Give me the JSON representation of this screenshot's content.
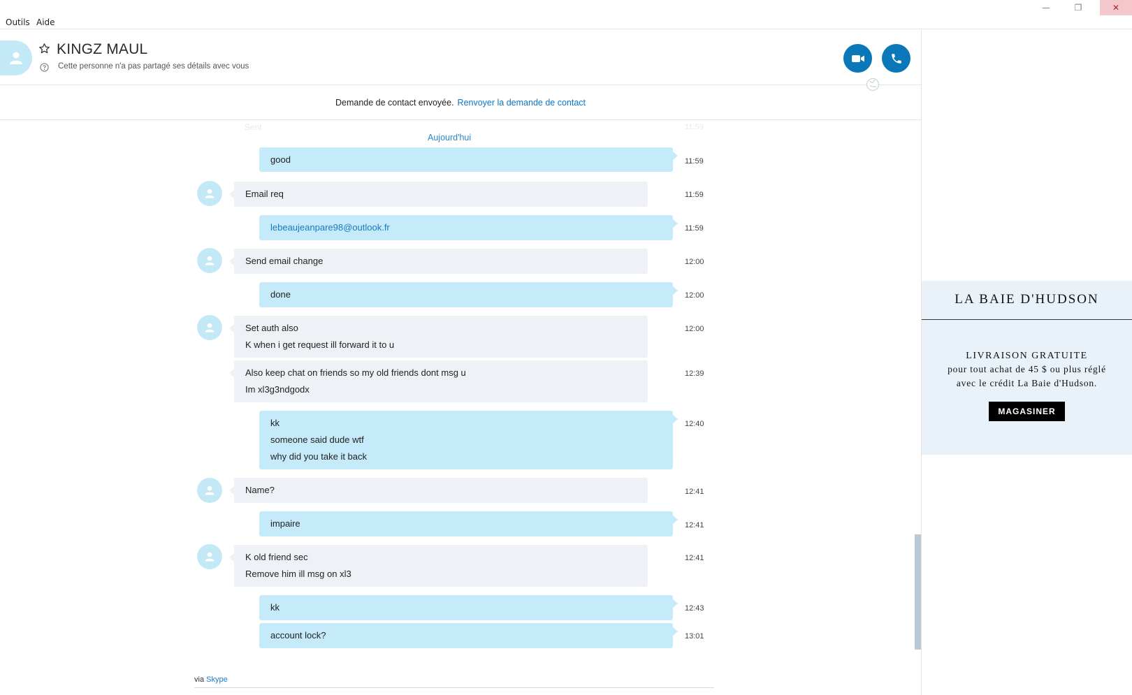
{
  "menu": {
    "items": [
      "Outils",
      "Aide"
    ]
  },
  "window_controls": {
    "minimize": "—",
    "maximize": "❐",
    "close": "✕"
  },
  "header": {
    "contact_name": "KINGZ MAUL",
    "status": "Cette personne n'a pas partagé ses détails avec vous"
  },
  "request_notice": {
    "text": "Demande de contact envoyée.",
    "link": "Renvoyer la demande de contact"
  },
  "chat": {
    "faded_top_text": "Sent",
    "faded_top_time": "11:59",
    "day_label": "Aujourd'hui",
    "messages": [
      {
        "direction": "out",
        "lines": [
          "good"
        ],
        "time": "11:59"
      },
      {
        "direction": "in",
        "lines": [
          "Email req"
        ],
        "time": "11:59"
      },
      {
        "direction": "out",
        "lines": [
          "lebeaujeanpare98@outlook.fr"
        ],
        "time": "11:59"
      },
      {
        "direction": "in",
        "lines": [
          "Send email change"
        ],
        "time": "12:00"
      },
      {
        "direction": "out",
        "lines": [
          "done"
        ],
        "time": "12:00"
      },
      {
        "direction": "in",
        "lines": [
          "Set auth also",
          "K when i get request ill forward it to u"
        ],
        "time": "12:00"
      },
      {
        "direction": "in",
        "lines": [
          "Also keep chat on friends so my old friends dont msg u",
          "Im xl3g3ndgodx"
        ],
        "time": "12:39"
      },
      {
        "direction": "out",
        "lines": [
          "kk",
          "someone said dude wtf",
          "why did you take it back"
        ],
        "time": "12:40"
      },
      {
        "direction": "in",
        "lines": [
          "Name?"
        ],
        "time": "12:41"
      },
      {
        "direction": "out",
        "lines": [
          "impaire"
        ],
        "time": "12:41"
      },
      {
        "direction": "in",
        "lines": [
          "K old friend sec",
          "Remove him ill msg on xl3"
        ],
        "time": "12:41"
      },
      {
        "direction": "out",
        "lines": [
          "kk"
        ],
        "time": "12:43"
      },
      {
        "direction": "out",
        "lines": [
          "account lock?"
        ],
        "time": "13:01"
      }
    ],
    "via_prefix": "via",
    "via_link": "Skype"
  },
  "ad": {
    "logo": "LA BAIE D'HUDSON",
    "headline": "LIVRAISON GRATUITE",
    "body_line1": "pour tout achat de 45 $ ou plus réglé",
    "body_line2": "avec le crédit La Baie d'Hudson.",
    "button": "MAGASINER"
  },
  "colors": {
    "accent": "#0a78b8",
    "link": "#1878c0",
    "bubble_out": "#c5eafa",
    "bubble_in": "#eef1f5",
    "avatar_bg": "#c3e9f6",
    "ad_bg": "#e9f2f9"
  },
  "icons": {
    "star": "star-icon",
    "help": "help-icon",
    "video": "video-call-icon",
    "phone": "phone-icon",
    "globe": "globe-icon",
    "avatar": "user-avatar-icon"
  }
}
